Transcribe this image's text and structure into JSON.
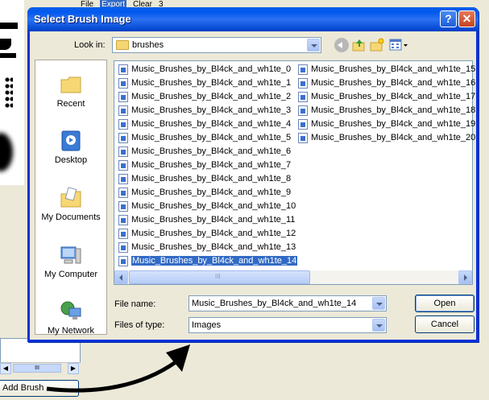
{
  "background_app": {
    "menu": [
      "File",
      "Export",
      "Clear",
      "3"
    ],
    "add_brush_label": "Add Brush",
    "scroll_thumb_label": "III"
  },
  "dialog": {
    "title": "Select Brush Image",
    "help_glyph": "?",
    "close_glyph": "✕",
    "look_in_label": "Look in:",
    "look_in_value": "brushes",
    "places": [
      {
        "label": "Recent",
        "icon": "recent-folder-icon"
      },
      {
        "label": "Desktop",
        "icon": "desktop-icon"
      },
      {
        "label": "My Documents",
        "icon": "my-documents-icon"
      },
      {
        "label": "My Computer",
        "icon": "my-computer-icon"
      },
      {
        "label": "My Network",
        "icon": "my-network-icon"
      }
    ],
    "files_col1": [
      "Music_Brushes_by_Bl4ck_and_wh1te_0",
      "Music_Brushes_by_Bl4ck_and_wh1te_1",
      "Music_Brushes_by_Bl4ck_and_wh1te_2",
      "Music_Brushes_by_Bl4ck_and_wh1te_3",
      "Music_Brushes_by_Bl4ck_and_wh1te_4",
      "Music_Brushes_by_Bl4ck_and_wh1te_5",
      "Music_Brushes_by_Bl4ck_and_wh1te_6",
      "Music_Brushes_by_Bl4ck_and_wh1te_7",
      "Music_Brushes_by_Bl4ck_and_wh1te_8",
      "Music_Brushes_by_Bl4ck_and_wh1te_9",
      "Music_Brushes_by_Bl4ck_and_wh1te_10",
      "Music_Brushes_by_Bl4ck_and_wh1te_11",
      "Music_Brushes_by_Bl4ck_and_wh1te_12",
      "Music_Brushes_by_Bl4ck_and_wh1te_13",
      "Music_Brushes_by_Bl4ck_and_wh1te_14"
    ],
    "files_col2": [
      "Music_Brushes_by_Bl4ck_and_wh1te_15",
      "Music_Brushes_by_Bl4ck_and_wh1te_16",
      "Music_Brushes_by_Bl4ck_and_wh1te_17",
      "Music_Brushes_by_Bl4ck_and_wh1te_18",
      "Music_Brushes_by_Bl4ck_and_wh1te_19",
      "Music_Brushes_by_Bl4ck_and_wh1te_20"
    ],
    "selected_file": "Music_Brushes_by_Bl4ck_and_wh1te_14",
    "scroll_thumb_label": "III",
    "file_name_label": "File name:",
    "file_name_value": "Music_Brushes_by_Bl4ck_and_wh1te_14",
    "file_type_label": "Files of type:",
    "file_type_value": "Images",
    "open_label": "Open",
    "cancel_label": "Cancel"
  },
  "colors": {
    "title_bar": "#0058ee",
    "selection": "#316ac5",
    "dialog_bg": "#ece9d8"
  }
}
